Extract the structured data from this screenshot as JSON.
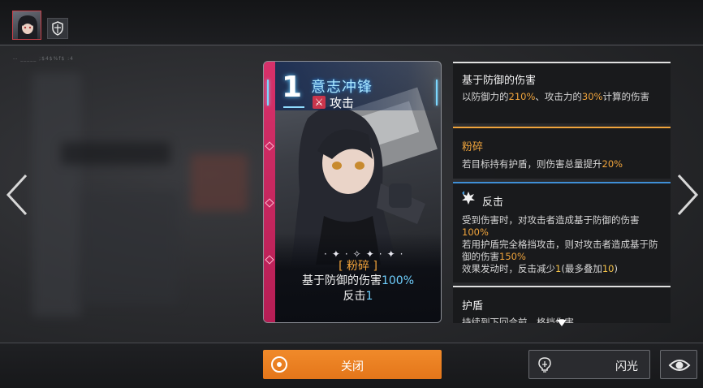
{
  "colors": {
    "accent_orange": "#f08a2a",
    "keyword_orange": "#f0a43c",
    "value_blue": "#6fd0ff",
    "card_strip": "#d7316a"
  },
  "header": {
    "avatar_icon": "character-portrait",
    "shield_icon": "shield-icon",
    "debug_text": "-- _____ ;$4$%f$ :4"
  },
  "card": {
    "cost": "1",
    "name": "意志冲锋",
    "type_icon": "crossed-swords-icon",
    "type": "攻击",
    "keyword": "[ 粉碎 ]",
    "desc_line1_prefix": "基于防御的伤害",
    "desc_line1_value": "100%",
    "desc_line2_prefix": "反击",
    "desc_line2_value": "1"
  },
  "panels": [
    {
      "title": "基于防御的伤害",
      "text_parts": [
        "以防御力的",
        "210%",
        "、攻击力的",
        "30%",
        "计算的伤害"
      ]
    },
    {
      "title": "粉碎",
      "text_parts": [
        "若目标持有护盾，则伤害总量提升",
        "20%"
      ]
    },
    {
      "title": "反击",
      "icon": "counter-burst-icon",
      "lines": [
        [
          "受到伤害时，对攻击者造成基于防御的伤害",
          "100%"
        ],
        [
          "若用护盾完全格挡攻击，则对攻击者造成基于防御的伤害",
          "150%"
        ],
        [
          "效果发动时，反击减少",
          "1",
          "(最多叠加",
          "10",
          ")"
        ]
      ]
    },
    {
      "title": "护盾",
      "text_partial": "持续到下回合前，格挡伤害"
    }
  ],
  "footer": {
    "close_label": "关闭",
    "flash_label": "闪光",
    "flash_icon": "lightbulb-icon",
    "eye_icon": "eye-icon"
  }
}
